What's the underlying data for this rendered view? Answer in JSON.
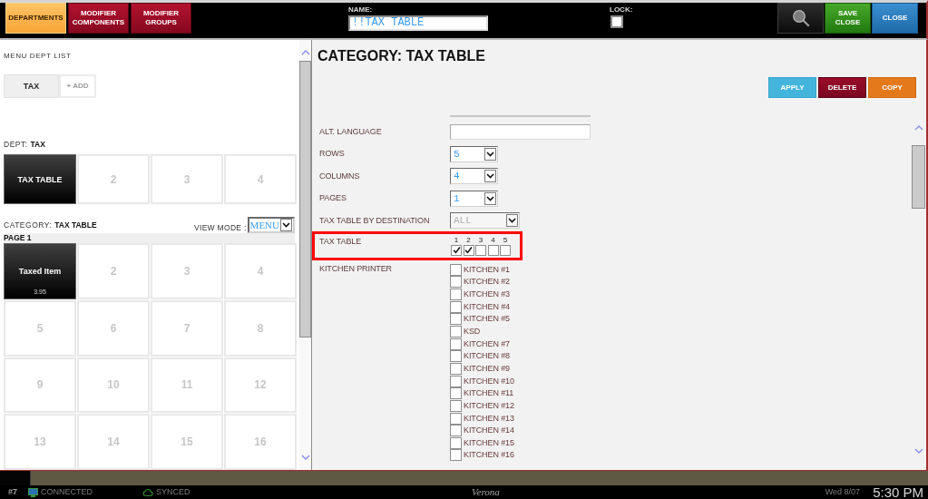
{
  "header": {
    "tabs": [
      {
        "label": "DEPARTMENTS",
        "selected": true
      },
      {
        "label": "MODIFIER COMPONENTS",
        "selected": false
      },
      {
        "label": "MODIFIER GROUPS",
        "selected": false
      }
    ],
    "name_field": {
      "label": "NAME:",
      "value": "!!TAX TABLE"
    },
    "lock": {
      "label": "LOCK:",
      "checked": false
    },
    "buttons": [
      {
        "kind": "search"
      },
      {
        "kind": "save",
        "label": "SAVE CLOSE"
      },
      {
        "kind": "close",
        "label": "CLOSE"
      }
    ]
  },
  "left_panel": {
    "title": "MENU DEPT LIST",
    "dept_tabs": [
      {
        "label": "TAX",
        "selected": true
      }
    ],
    "add_button": "+ ADD",
    "dept_heading": {
      "label": "DEPT:",
      "value": "TAX"
    },
    "dept_buttons": [
      {
        "kind": "filled",
        "label": "TAX TABLE"
      },
      {
        "kind": "empty",
        "label": "2"
      },
      {
        "kind": "empty",
        "label": "3"
      },
      {
        "kind": "empty",
        "label": "4"
      }
    ],
    "category_heading": {
      "label": "CATEGORY:",
      "value": "TAX TABLE"
    },
    "view_mode": {
      "label": "VIEW MODE :",
      "value": "MENU"
    },
    "page_label": "PAGE 1",
    "items": [
      {
        "kind": "filled",
        "label": "Taxed Item",
        "price": "3.95"
      },
      {
        "kind": "empty",
        "label": "2"
      },
      {
        "kind": "empty",
        "label": "3"
      },
      {
        "kind": "empty",
        "label": "4"
      },
      {
        "kind": "empty",
        "label": "5"
      },
      {
        "kind": "empty",
        "label": "6"
      },
      {
        "kind": "empty",
        "label": "7"
      },
      {
        "kind": "empty",
        "label": "8"
      },
      {
        "kind": "empty",
        "label": "9"
      },
      {
        "kind": "empty",
        "label": "10"
      },
      {
        "kind": "empty",
        "label": "11"
      },
      {
        "kind": "empty",
        "label": "12"
      },
      {
        "kind": "empty",
        "label": "13"
      },
      {
        "kind": "empty",
        "label": "14"
      },
      {
        "kind": "empty",
        "label": "15"
      },
      {
        "kind": "empty",
        "label": "16"
      }
    ]
  },
  "editor": {
    "title": "CATEGORY: TAX TABLE",
    "actions": [
      {
        "kind": "apply",
        "label": "APPLY"
      },
      {
        "kind": "delete",
        "label": "DELETE"
      },
      {
        "kind": "copy",
        "label": "COPY"
      }
    ],
    "fields": [
      {
        "kind": "text",
        "label": "ALT. LANGUAGE"
      },
      {
        "kind": "select",
        "label": "ROWS",
        "value": "5",
        "disabled": false
      },
      {
        "kind": "select",
        "label": "COLUMNS",
        "value": "4",
        "disabled": false
      },
      {
        "kind": "select",
        "label": "PAGES",
        "value": "1",
        "disabled": false
      },
      {
        "kind": "select",
        "label": "TAX TABLE BY DESTINATION",
        "value": "ALL",
        "disabled": true
      },
      {
        "kind": "checkgrid",
        "label": "TAX TABLE",
        "highlighted": true,
        "options": [
          {
            "label": "1",
            "checked": true
          },
          {
            "label": "2",
            "checked": true
          },
          {
            "label": "3",
            "checked": false
          },
          {
            "label": "4",
            "checked": false
          },
          {
            "label": "5",
            "checked": false
          }
        ]
      },
      {
        "kind": "checklist",
        "label": "KITCHEN PRINTER",
        "options": [
          {
            "label": "KITCHEN #1",
            "checked": false
          },
          {
            "label": "KITCHEN #2",
            "checked": false
          },
          {
            "label": "KITCHEN #3",
            "checked": false
          },
          {
            "label": "KITCHEN #4",
            "checked": false
          },
          {
            "label": "KITCHEN #5",
            "checked": false
          },
          {
            "label": "KSD",
            "checked": false
          },
          {
            "label": "KITCHEN #7",
            "checked": false
          },
          {
            "label": "KITCHEN #8",
            "checked": false
          },
          {
            "label": "KITCHEN #9",
            "checked": false
          },
          {
            "label": "KITCHEN #10",
            "checked": false
          },
          {
            "label": "KITCHEN #11",
            "checked": false
          },
          {
            "label": "KITCHEN #12",
            "checked": false
          },
          {
            "label": "KITCHEN #13",
            "checked": false
          },
          {
            "label": "KITCHEN #14",
            "checked": false
          },
          {
            "label": "KITCHEN #15",
            "checked": false
          },
          {
            "label": "KITCHEN #16",
            "checked": false
          }
        ]
      }
    ]
  },
  "taskbar": {
    "badge": "#7",
    "connection": "CONNECTED",
    "sync": "SYNCED",
    "title": "Verona",
    "date": "Wed 8/07",
    "time": "5:30 PM"
  }
}
